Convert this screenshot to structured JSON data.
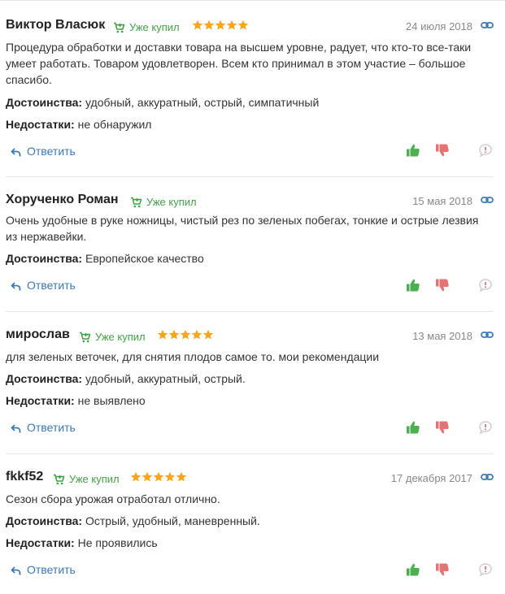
{
  "bought_label": "Уже купил",
  "reply_label": "Ответить",
  "colors": {
    "accent": "#3c79b6",
    "bought": "#43a047",
    "star": "#f9a61a",
    "like": "#4caf50",
    "dislike": "#e57373",
    "complaint": "#cfcfcf"
  },
  "reviews": [
    {
      "author": "Виктор Власюк",
      "rating": 5,
      "date": "24 июля 2018",
      "text": "Процедура обработки и доставки товара на высшем уровне, радует, что кто-то все-таки умеет работать. Товаром удовлетворен. Всем кто принимал в этом участие – большое спасибо.",
      "pros_label": "Достоинства:",
      "pros": "удобный, аккуратный, острый, симпатичный",
      "cons_label": "Недостатки:",
      "cons": "не обнаружил"
    },
    {
      "author": "Хорученко Роман",
      "rating": 0,
      "date": "15 мая 2018",
      "text": "Очень удобные в руке ножницы, чистый рез по зеленых побегах, тонкие и острые лезвия из нержавейки.",
      "pros_label": "Достоинства:",
      "pros": "Европейское качество"
    },
    {
      "author": "мирослав",
      "rating": 5,
      "date": "13 мая 2018",
      "text": "для зеленых веточек, для снятия плодов самое то. мои рекомендации",
      "pros_label": "Достоинства:",
      "pros": "удобный, аккуратный, острый.",
      "cons_label": "Недостатки:",
      "cons": "не выявлено"
    },
    {
      "author": "fkkf52",
      "rating": 5,
      "date": "17 декабря 2017",
      "text": "Сезон сбора урожая отработал отлично.",
      "pros_label": "Достоинства:",
      "pros": "Острый, удобный, маневренный.",
      "cons_label": "Недостатки:",
      "cons": "Не проявились"
    }
  ]
}
